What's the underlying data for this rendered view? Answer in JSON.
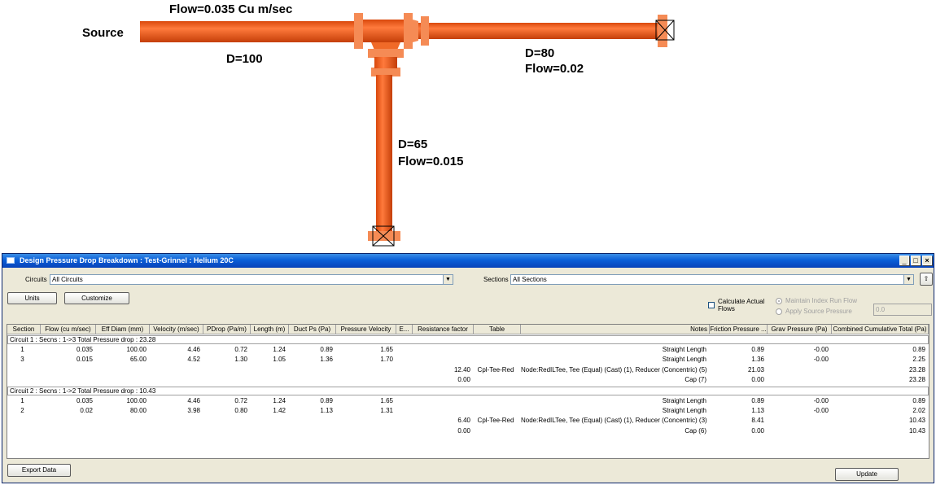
{
  "diagram": {
    "source_label": "Source",
    "flow_main": "Flow=0.035 Cu m/sec",
    "d_main": "D=100",
    "d_branch_right": "D=80",
    "flow_branch_right": "Flow=0.02",
    "d_branch_down": "D=65",
    "flow_branch_down": "Flow=0.015",
    "pipe_color": "#f05a14",
    "fitting_color": "#f58b55"
  },
  "window": {
    "title": "Design Pressure Drop Breakdown : Test-Grinnel : Helium 20C",
    "minimize": "_",
    "maximize": "□",
    "close": "×"
  },
  "filters": {
    "circuits_label": "Circuits",
    "circuits_value": "All Circuits",
    "sections_label": "Sections",
    "sections_value": "All Sections"
  },
  "buttons": {
    "units": "Units",
    "customize": "Customize",
    "export": "Export Data",
    "update": "Update"
  },
  "options": {
    "calc_actual_flows": "Calculate Actual Flows",
    "maintain_index": "Maintain Index Run Flow",
    "apply_source": "Apply Source Pressure",
    "source_value": "0.0"
  },
  "table": {
    "headers": [
      "Section",
      "Flow (cu m/sec)",
      "Eff Diam (mm)",
      "Velocity (m/sec)",
      "PDrop (Pa/m)",
      "Length (m)",
      "Duct Ps (Pa)",
      "Pressure Velocity",
      "E...",
      "Resistance factor",
      "Table",
      "Notes",
      "Friction Pressure ...",
      "Grav Pressure (Pa)",
      "Combined Cumulative Total (Pa)"
    ],
    "circuits": [
      {
        "title": "Circuit 1 : Secns : 1->3 Total Pressure drop : 23.28",
        "rows": [
          [
            "1",
            "0.035",
            "100.00",
            "4.46",
            "0.72",
            "1.24",
            "0.89",
            "1.65",
            "",
            "",
            "",
            "Straight Length",
            "0.89",
            "-0.00",
            "0.89"
          ],
          [
            "3",
            "0.015",
            "65.00",
            "4.52",
            "1.30",
            "1.05",
            "1.36",
            "1.70",
            "",
            "",
            "",
            "Straight Length",
            "1.36",
            "-0.00",
            "2.25"
          ],
          [
            "",
            "",
            "",
            "",
            "",
            "",
            "",
            "",
            "",
            "12.40",
            "Cpl-Tee-Red",
            "Node:RedILTee, Tee (Equal) (Cast) (1), Reducer (Concentric) (5)",
            "21.03",
            "",
            "23.28"
          ],
          [
            "",
            "",
            "",
            "",
            "",
            "",
            "",
            "",
            "",
            "0.00",
            "",
            "Cap (7)",
            "0.00",
            "",
            "23.28"
          ]
        ]
      },
      {
        "title": "Circuit 2 : Secns : 1->2 Total Pressure drop : 10.43",
        "rows": [
          [
            "1",
            "0.035",
            "100.00",
            "4.46",
            "0.72",
            "1.24",
            "0.89",
            "1.65",
            "",
            "",
            "",
            "Straight Length",
            "0.89",
            "-0.00",
            "0.89"
          ],
          [
            "2",
            "0.02",
            "80.00",
            "3.98",
            "0.80",
            "1.42",
            "1.13",
            "1.31",
            "",
            "",
            "",
            "Straight Length",
            "1.13",
            "-0.00",
            "2.02"
          ],
          [
            "",
            "",
            "",
            "",
            "",
            "",
            "",
            "",
            "",
            "6.40",
            "Cpl-Tee-Red",
            "Node:RedILTee, Tee (Equal) (Cast) (1), Reducer (Concentric) (3)",
            "8.41",
            "",
            "10.43"
          ],
          [
            "",
            "",
            "",
            "",
            "",
            "",
            "",
            "",
            "",
            "0.00",
            "",
            "Cap (6)",
            "0.00",
            "",
            "10.43"
          ]
        ]
      }
    ]
  }
}
